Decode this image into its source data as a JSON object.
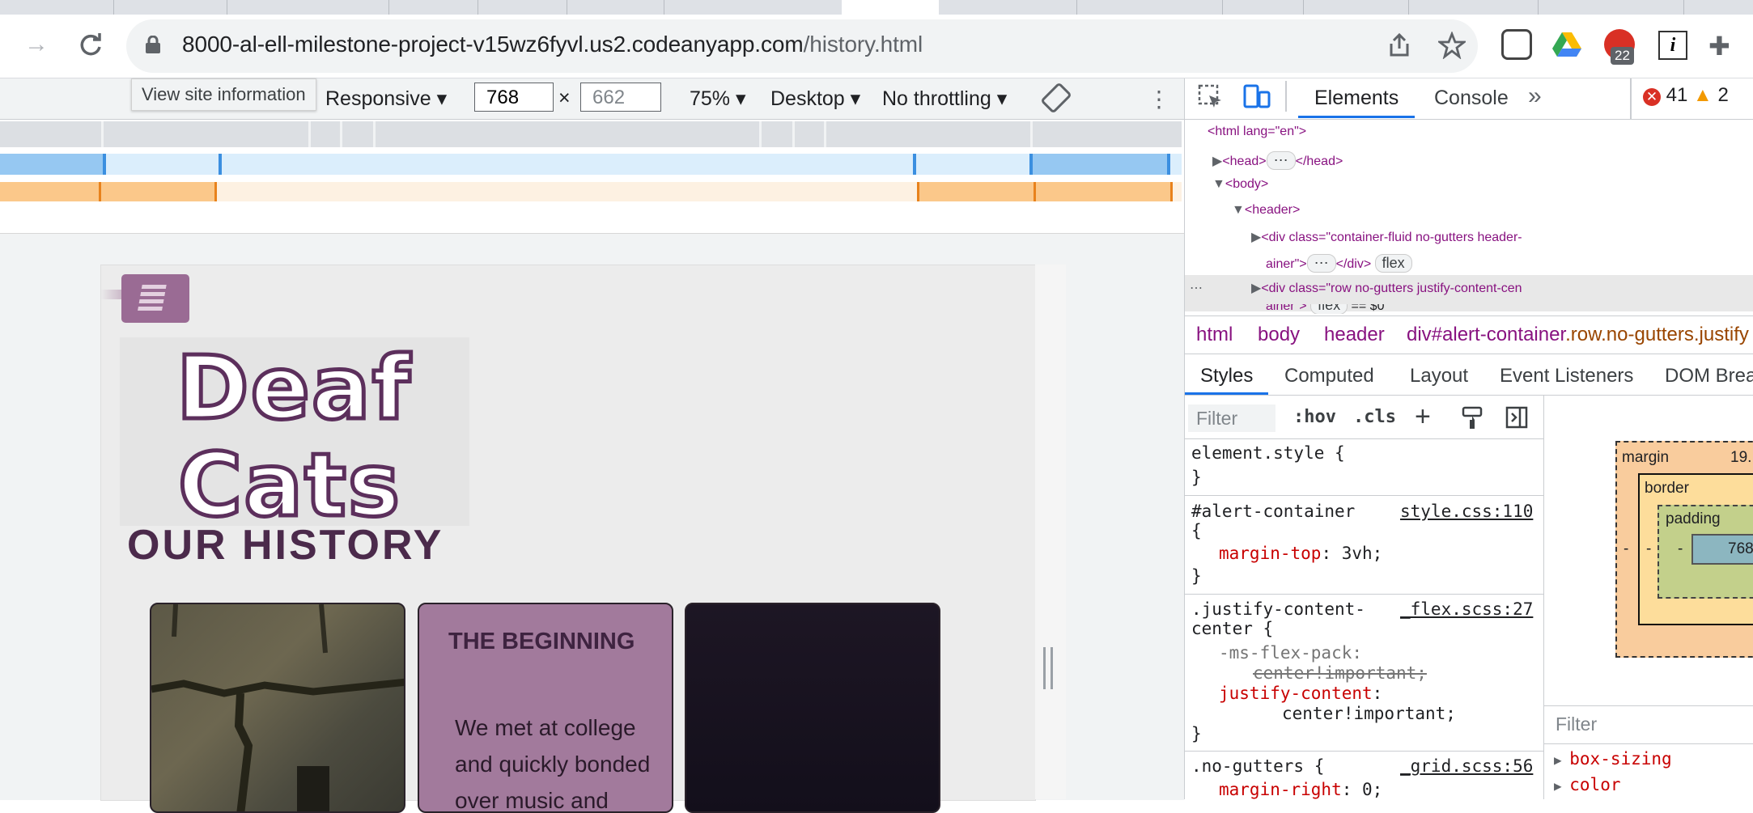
{
  "browser": {
    "url_host": "8000-al-ell-milestone-project-v15wz6fyvl.us2.codeanyapp.com",
    "url_path": "/history.html",
    "tooltip": "View site information",
    "extension_badge": "22"
  },
  "device_toolbar": {
    "mode": "Responsive",
    "width": "768",
    "height_placeholder": "662",
    "times": "×",
    "zoom": "75%",
    "device_type": "Desktop",
    "throttling": "No throttling"
  },
  "page": {
    "logo_line1": "Deaf",
    "logo_line2": "Cats",
    "title": "OUR HISTORY",
    "card_title": "THE BEGINNING",
    "card_text": "We met at college and quickly bonded over music and"
  },
  "devtools": {
    "tabs": [
      "Elements",
      "Console"
    ],
    "more": "»",
    "errors": "41",
    "warnings": "2",
    "dom": {
      "html_open": "<html lang=\"en\">",
      "head": "<head>",
      "head_close": "</head>",
      "body": "<body>",
      "header": "<header>",
      "div1_a": "<div class=\"container-fluid no-gutters header-",
      "div1_b": "ainer\">",
      "div1_close": "</div>",
      "div2_a": "<div class=\"row no-gutters justify-content-cen",
      "div2_b": "ainer\">",
      "flex": "flex",
      "dollar": "== $0"
    },
    "breadcrumb": [
      "html",
      "body",
      "header",
      "div#alert-container",
      ".row.no-gutters.justify"
    ],
    "style_tabs": [
      "Styles",
      "Computed",
      "Layout",
      "Event Listeners",
      "DOM Brea"
    ],
    "filter_placeholder": "Filter",
    "hov": ":hov",
    "cls": ".cls",
    "rules": {
      "element_style": "element.style {",
      "close": "}",
      "alert_selector": "#alert-container",
      "alert_src": "style.css:110",
      "alert_open": "{",
      "alert_prop": "margin-top",
      "alert_val": ": 3vh;",
      "justify_selector": ".justify-content-",
      "justify_selector2": "center {",
      "justify_src": "_flex.scss:27",
      "ms_prop": "-ms-flex-pack:",
      "ms_val": "center!important;",
      "jc_prop": "justify-content",
      "jc_colon": ":",
      "jc_val": "center!important;",
      "nogutters_selector": ".no-gutters {",
      "nogutters_src": "_grid.scss:56",
      "mr_prop": "margin-right",
      "mr_val": ": 0;"
    },
    "box_model": {
      "margin": "margin",
      "margin_value": "19.",
      "border": "border",
      "padding": "padding",
      "content": "768",
      "dash": "-"
    },
    "computed": {
      "filter": "Filter",
      "items": [
        "box-sizing",
        "color"
      ]
    }
  },
  "colors": {
    "accent": "#1a73e8",
    "brand_purple": "#5c2f5c",
    "card_purple": "#a27a9c"
  },
  "icons": [
    "back-arrow-icon",
    "reload-icon",
    "lock-icon",
    "share-icon",
    "star-icon",
    "inspect-icon",
    "device-icon",
    "rotate-icon",
    "more-vert-icon",
    "error-icon",
    "warning-icon"
  ]
}
